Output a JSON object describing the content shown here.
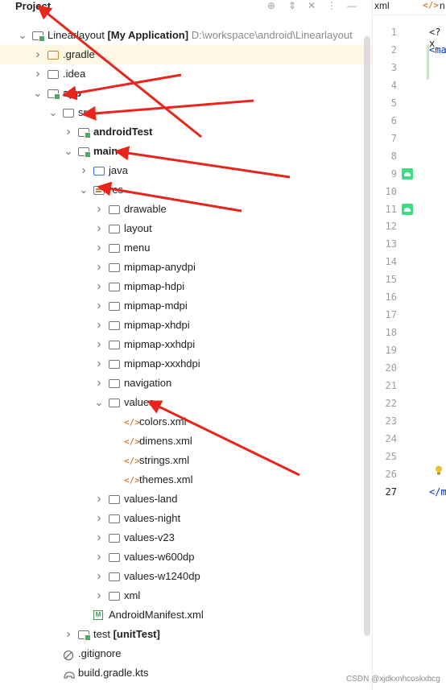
{
  "panel": {
    "title": "Project"
  },
  "tree": [
    {
      "label": "Linearlayout",
      "extra": "[My Application]",
      "path": "D:\\workspace\\android\\Linearlayout",
      "depth": 0,
      "chevron": "down",
      "icon": "module-folder",
      "bold_extra": true
    },
    {
      "label": ".gradle",
      "depth": 1,
      "chevron": "right",
      "icon": "orange-folder",
      "highlight": true
    },
    {
      "label": ".idea",
      "depth": 1,
      "chevron": "right",
      "icon": "folder"
    },
    {
      "label": "app",
      "depth": 1,
      "chevron": "down",
      "icon": "module-folder",
      "bold": true
    },
    {
      "label": "src",
      "depth": 2,
      "chevron": "down",
      "icon": "folder"
    },
    {
      "label": "androidTest",
      "depth": 3,
      "chevron": "right",
      "icon": "module-folder",
      "bold": true
    },
    {
      "label": "main",
      "depth": 3,
      "chevron": "down",
      "icon": "module-folder",
      "bold": true
    },
    {
      "label": "java",
      "depth": 4,
      "chevron": "right",
      "icon": "blue-folder"
    },
    {
      "label": "res",
      "depth": 4,
      "chevron": "down",
      "icon": "res-folder"
    },
    {
      "label": "drawable",
      "depth": 5,
      "chevron": "right",
      "icon": "folder"
    },
    {
      "label": "layout",
      "depth": 5,
      "chevron": "right",
      "icon": "folder"
    },
    {
      "label": "menu",
      "depth": 5,
      "chevron": "right",
      "icon": "folder"
    },
    {
      "label": "mipmap-anydpi",
      "depth": 5,
      "chevron": "right",
      "icon": "folder"
    },
    {
      "label": "mipmap-hdpi",
      "depth": 5,
      "chevron": "right",
      "icon": "folder"
    },
    {
      "label": "mipmap-mdpi",
      "depth": 5,
      "chevron": "right",
      "icon": "folder"
    },
    {
      "label": "mipmap-xhdpi",
      "depth": 5,
      "chevron": "right",
      "icon": "folder"
    },
    {
      "label": "mipmap-xxhdpi",
      "depth": 5,
      "chevron": "right",
      "icon": "folder"
    },
    {
      "label": "mipmap-xxxhdpi",
      "depth": 5,
      "chevron": "right",
      "icon": "folder"
    },
    {
      "label": "navigation",
      "depth": 5,
      "chevron": "right",
      "icon": "folder"
    },
    {
      "label": "values",
      "depth": 5,
      "chevron": "down",
      "icon": "folder"
    },
    {
      "label": "colors.xml",
      "depth": 6,
      "chevron": "",
      "icon": "xml-file"
    },
    {
      "label": "dimens.xml",
      "depth": 6,
      "chevron": "",
      "icon": "xml-file"
    },
    {
      "label": "strings.xml",
      "depth": 6,
      "chevron": "",
      "icon": "xml-file"
    },
    {
      "label": "themes.xml",
      "depth": 6,
      "chevron": "",
      "icon": "xml-file"
    },
    {
      "label": "values-land",
      "depth": 5,
      "chevron": "right",
      "icon": "folder"
    },
    {
      "label": "values-night",
      "depth": 5,
      "chevron": "right",
      "icon": "folder"
    },
    {
      "label": "values-v23",
      "depth": 5,
      "chevron": "right",
      "icon": "folder"
    },
    {
      "label": "values-w600dp",
      "depth": 5,
      "chevron": "right",
      "icon": "folder"
    },
    {
      "label": "values-w1240dp",
      "depth": 5,
      "chevron": "right",
      "icon": "folder"
    },
    {
      "label": "xml",
      "depth": 5,
      "chevron": "right",
      "icon": "folder"
    },
    {
      "label": "AndroidManifest.xml",
      "depth": 4,
      "chevron": "",
      "icon": "manifest-file"
    },
    {
      "label": "test",
      "extra": "[unitTest]",
      "depth": 3,
      "chevron": "right",
      "icon": "module-folder",
      "bold_extra": true
    },
    {
      "label": ".gitignore",
      "depth": 2,
      "chevron": "",
      "icon": "gitignore-file"
    },
    {
      "label": "build.gradle.kts",
      "depth": 2,
      "chevron": "",
      "icon": "gradle-file"
    }
  ],
  "editor": {
    "tab1": "xml",
    "tab2": "n",
    "line_numbers": [
      "1",
      "2",
      "3",
      "4",
      "5",
      "6",
      "7",
      "8",
      "9",
      "10",
      "11",
      "12",
      "13",
      "14",
      "15",
      "16",
      "17",
      "18",
      "19",
      "20",
      "21",
      "22",
      "23",
      "24",
      "25",
      "26",
      "27"
    ],
    "current_line": "27",
    "gutter_icon_lines": [
      "9",
      "11"
    ],
    "code_lines": {
      "1": "<?x",
      "2": "<ma",
      "27": "</m"
    }
  },
  "watermark": "CSDN @xjdkxnhcoskxbcg",
  "colors": {
    "arrow": "#e8251c",
    "highlight": "#fdf7e3",
    "xml_tag": "#0033b3",
    "module_dot": "#58a664"
  }
}
